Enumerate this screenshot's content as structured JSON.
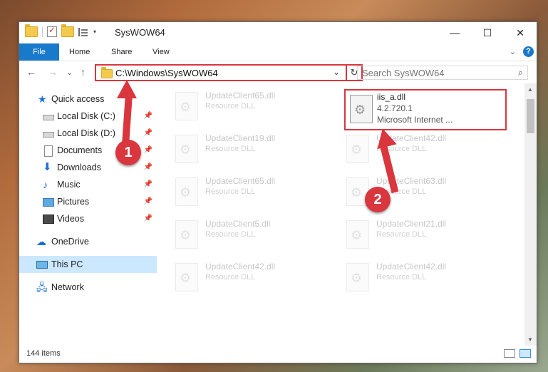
{
  "window": {
    "title": "SysWOW64",
    "caption": {
      "minimize": "—",
      "maximize": "☐",
      "close": "✕"
    }
  },
  "ribbon": {
    "tabs": [
      "File",
      "Home",
      "Share",
      "View"
    ],
    "expand_icon": "chevron-down-icon",
    "help_label": "?"
  },
  "nav": {
    "back": "←",
    "forward": "→",
    "recent": "⌄",
    "up": "↑",
    "address": "C:\\Windows\\SysWOW64",
    "search_placeholder": "Search SysWOW64"
  },
  "sidebar": {
    "items": [
      {
        "label": "Quick access",
        "icon": "star-icon"
      },
      {
        "label": "Local Disk (C:)",
        "icon": "disk-icon",
        "pinned": true
      },
      {
        "label": "Local Disk (D:)",
        "icon": "disk-icon",
        "pinned": true
      },
      {
        "label": "Documents",
        "icon": "documents-icon",
        "pinned": true
      },
      {
        "label": "Downloads",
        "icon": "download-icon",
        "pinned": true
      },
      {
        "label": "Music",
        "icon": "music-icon",
        "pinned": true
      },
      {
        "label": "Pictures",
        "icon": "pictures-icon",
        "pinned": true
      },
      {
        "label": "Videos",
        "icon": "videos-icon",
        "pinned": true
      },
      {
        "label": "OneDrive",
        "icon": "cloud-icon"
      },
      {
        "label": "This PC",
        "icon": "computer-icon",
        "selected": true
      },
      {
        "label": "Network",
        "icon": "network-icon"
      }
    ]
  },
  "files": [
    {
      "name": "UpdateClient65.dll",
      "desc": "Resource DLL"
    },
    {
      "name": "iis_a.dll",
      "desc": "4.2.720.1",
      "desc2": "Microsoft Internet ...",
      "highlighted": true
    },
    {
      "name": "UpdateClient19.dll",
      "desc": "Resource DLL"
    },
    {
      "name": "UpdateClient42.dll",
      "desc": "Resource DLL"
    },
    {
      "name": "UpdateClient65.dll",
      "desc": "Resource DLL"
    },
    {
      "name": "UpdateClient63.dll",
      "desc": "Resource DLL"
    },
    {
      "name": "UpdateClient5.dll",
      "desc": "Resource DLL"
    },
    {
      "name": "UpdateClient21.dll",
      "desc": "Resource DLL"
    },
    {
      "name": "UpdateClient42.dll",
      "desc": "Resource DLL"
    },
    {
      "name": "UpdateClient42.dll",
      "desc": "Resource DLL"
    }
  ],
  "status": {
    "items": "144 items"
  },
  "annotations": {
    "step1": "1",
    "step2": "2",
    "color": "#d9363e"
  }
}
